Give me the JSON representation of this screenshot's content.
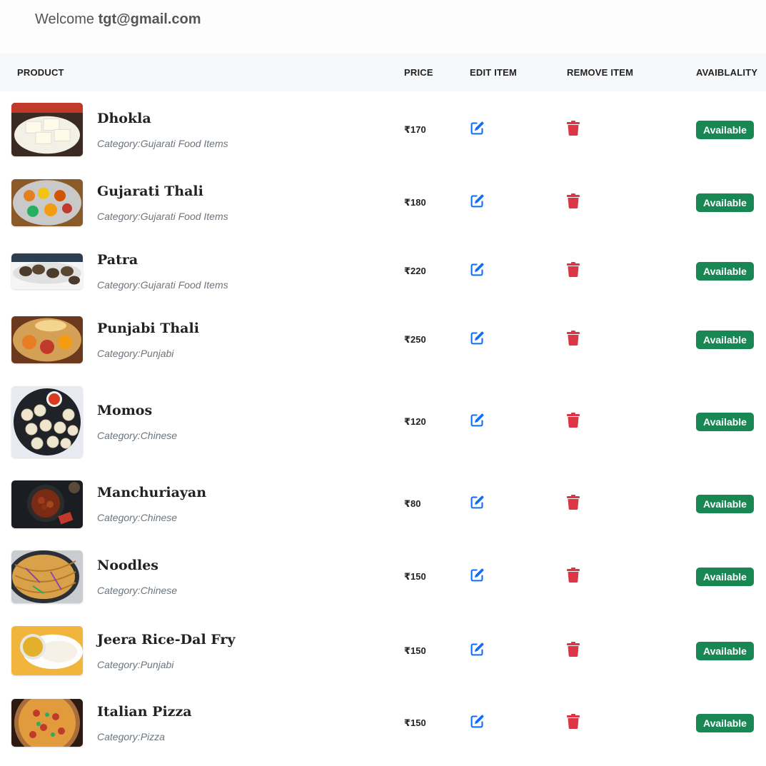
{
  "header": {
    "welcome_prefix": "Welcome",
    "user_email": "tgt@gmail.com"
  },
  "table": {
    "columns": {
      "product": "PRODUCT",
      "price": "PRICE",
      "edit": "EDIT ITEM",
      "remove": "REMOVE ITEM",
      "availability": "AVAIBLALITY"
    },
    "rows": [
      {
        "name": "Dhokla",
        "category": "Category:Gujarati Food Items",
        "price": "₹170",
        "status": "Available",
        "thumb": "dhokla-image"
      },
      {
        "name": "Gujarati Thali",
        "category": "Category:Gujarati Food Items",
        "price": "₹180",
        "status": "Available",
        "thumb": "gujarati-thali-image"
      },
      {
        "name": "Patra",
        "category": "Category:Gujarati Food Items",
        "price": "₹220",
        "status": "Available",
        "thumb": "patra-image"
      },
      {
        "name": "Punjabi Thali",
        "category": "Category:Punjabi",
        "price": "₹250",
        "status": "Available",
        "thumb": "punjabi-thali-image"
      },
      {
        "name": "Momos",
        "category": "Category:Chinese",
        "price": "₹120",
        "status": "Available",
        "thumb": "momos-image"
      },
      {
        "name": "Manchuriayan",
        "category": "Category:Chinese",
        "price": "₹80",
        "status": "Available",
        "thumb": "manchurian-image"
      },
      {
        "name": "Noodles",
        "category": "Category:Chinese",
        "price": "₹150",
        "status": "Available",
        "thumb": "noodles-image"
      },
      {
        "name": "Jeera Rice-Dal Fry",
        "category": "Category:Punjabi",
        "price": "₹150",
        "status": "Available",
        "thumb": "jeera-rice-image"
      },
      {
        "name": "Italian Pizza",
        "category": "Category:Pizza",
        "price": "₹150",
        "status": "Available",
        "thumb": "pizza-image"
      }
    ]
  },
  "colors": {
    "edit_icon": "#0d6efd",
    "delete_icon": "#dc3545",
    "badge_bg": "#198754",
    "header_bg": "#f7f8fa"
  },
  "icons": {
    "edit": "edit-pen-square-icon",
    "remove": "trash-icon"
  }
}
